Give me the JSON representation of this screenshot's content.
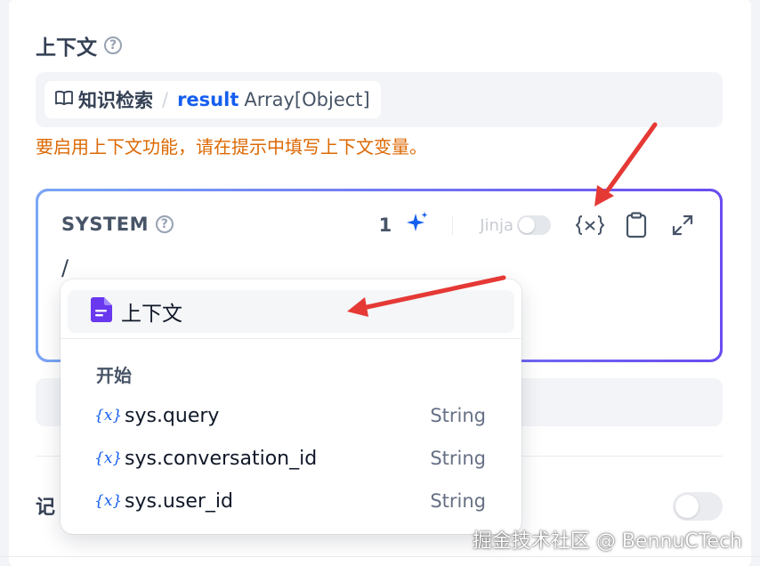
{
  "context": {
    "label": "上下文",
    "help": "?",
    "source_name": "知识检索",
    "separator": "/",
    "variable": "result",
    "variable_type": "Array[Object]",
    "warning": "要启用上下文功能，请在提示中填写上下文变量。"
  },
  "editor": {
    "role": "SYSTEM",
    "help": "?",
    "count": "1",
    "jinja_label": "Jinja",
    "content": "/"
  },
  "popup": {
    "context_item": "上下文",
    "group_label": "开始",
    "variables": [
      {
        "name": "sys.query",
        "type": "String"
      },
      {
        "name": "sys.conversation_id",
        "type": "String"
      },
      {
        "name": "sys.user_id",
        "type": "String"
      }
    ]
  },
  "memory": {
    "label": "记"
  },
  "watermark": "掘金技术社区 @ BennuCTech",
  "colors": {
    "accent": "#155eef",
    "warning": "#dc6803",
    "editor_border_start": "#7aa7f5",
    "editor_border_end": "#6a4cf0",
    "annotation_arrow": "#e53935",
    "doc_icon": "#6938ef"
  },
  "icons": {
    "help": "help-circle-icon",
    "book": "book-open-icon",
    "sparkle": "sparkle-icon",
    "variable": "variable-icon",
    "clipboard": "clipboard-icon",
    "expand": "expand-icon",
    "document": "document-icon"
  }
}
